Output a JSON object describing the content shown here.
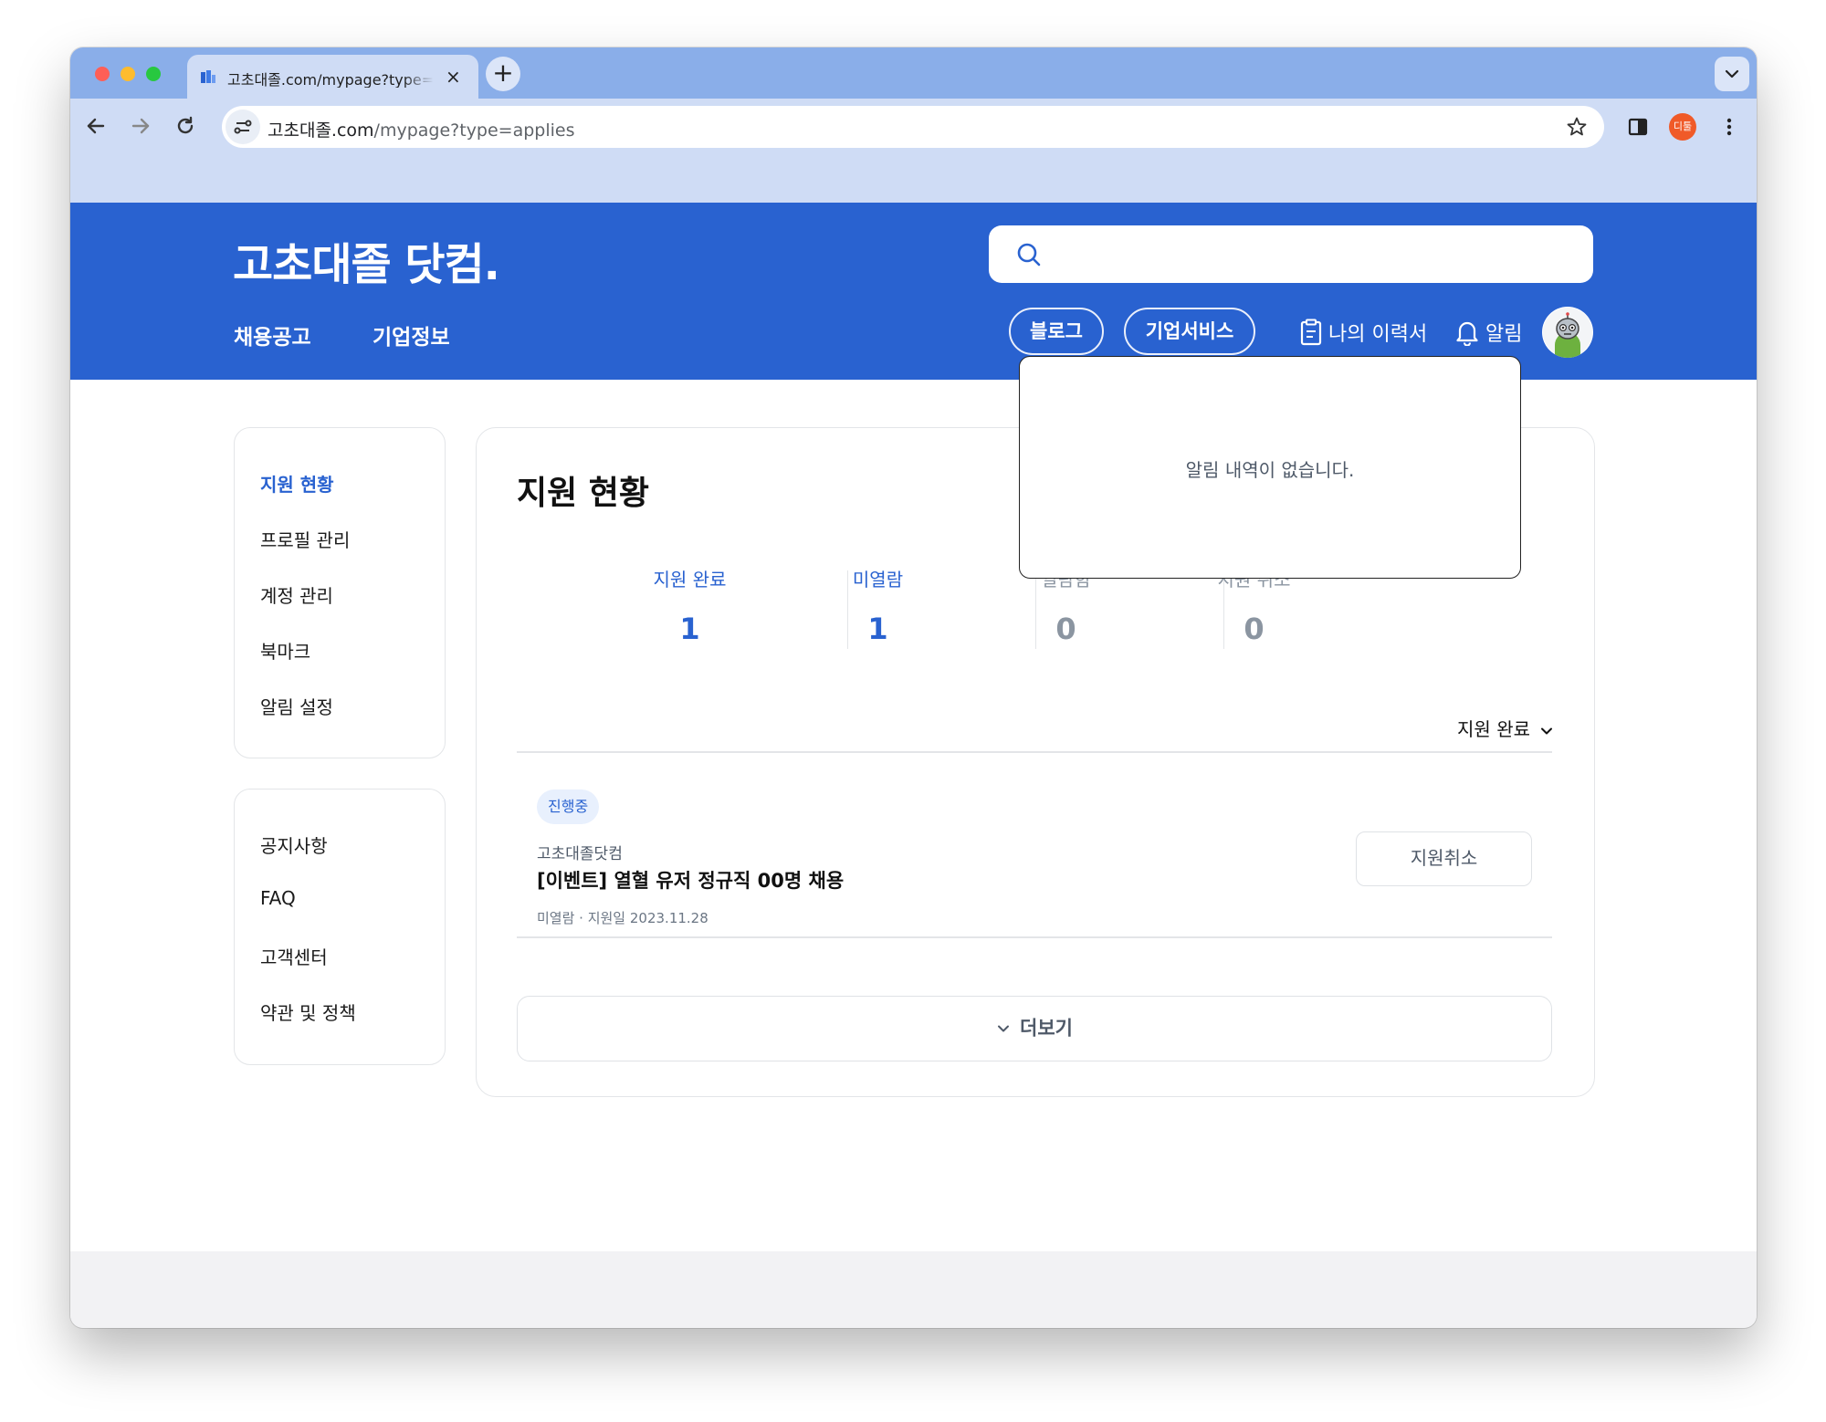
{
  "browser": {
    "tab_title": "고초대졸.com/mypage?type=applies",
    "url_host": "고초대졸.com",
    "url_path": "/mypage?type=applies",
    "profile_badge": "디툴"
  },
  "site": {
    "logo": "고초대졸 닷컴.",
    "nav": [
      "채용공고",
      "기업정보"
    ],
    "pills": [
      "블로그",
      "기업서비스"
    ],
    "resume_label": "나의 이력서",
    "alarm_label": "알림",
    "colors": {
      "brand": "#2962d0",
      "gray": "#8b95a1"
    }
  },
  "sidebar": {
    "menu": [
      "지원 현황",
      "프로필 관리",
      "계정 관리",
      "북마크",
      "알림 설정"
    ],
    "support": [
      "공지사항",
      "FAQ",
      "고객센터",
      "약관 및 정책"
    ]
  },
  "main": {
    "title": "지원 현황",
    "stats": [
      {
        "label": "지원 완료",
        "value": "1"
      },
      {
        "label": "미열람",
        "value": "1"
      },
      {
        "label": "열람함",
        "value": "0"
      },
      {
        "label": "지원 취소",
        "value": "0"
      }
    ],
    "filter_label": "지원 완료",
    "application": {
      "status": "진행중",
      "company": "고초대졸닷컴",
      "title": "[이벤트] 열혈 유저 정규직 00명 채용",
      "meta": "미열람 · 지원일 2023.11.28",
      "cancel_label": "지원취소"
    },
    "more_label": "더보기"
  },
  "notifications": {
    "empty_text": "알림 내역이 없습니다."
  }
}
